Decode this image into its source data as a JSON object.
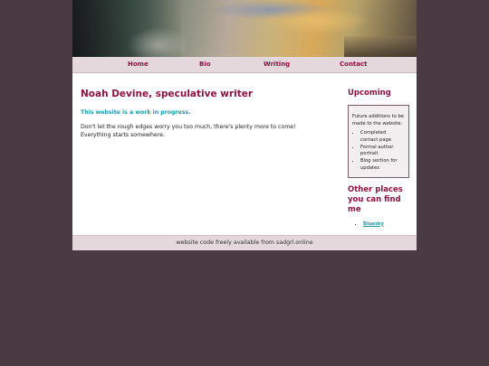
{
  "nav": {
    "items": [
      {
        "label": "Home"
      },
      {
        "label": "Bio"
      },
      {
        "label": "Writing"
      },
      {
        "label": "Contact"
      }
    ]
  },
  "main": {
    "title": "Noah Devine, speculative writer",
    "notice": "This website is a work in progress.",
    "body": "Don't let the rough edges worry you too much, there's plenty more to come! Everything starts somewhere."
  },
  "sidebar": {
    "upcoming_heading": "Upcoming",
    "box_intro": "Future additions to be made to the website:",
    "box_items": [
      "Completed contact page",
      "Formal author portrait",
      "Blog section for updates"
    ],
    "others_heading": "Other places you can find me",
    "links": [
      {
        "label": "Bluesky"
      }
    ]
  },
  "footer": {
    "text": "website code freely available from sadgrl.online"
  },
  "colors": {
    "accent": "#8a1340",
    "link": "#1e9aa6",
    "background": "#4a3a42"
  }
}
